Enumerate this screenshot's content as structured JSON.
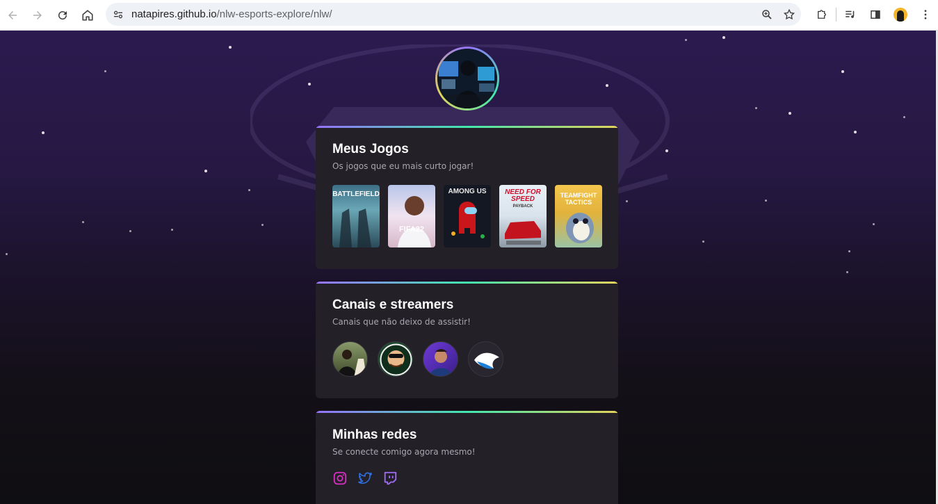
{
  "browser": {
    "url_host": "natapires.github.io",
    "url_path": "/nlw-esports-explore/nlw/"
  },
  "sections": {
    "games": {
      "title": "Meus Jogos",
      "subtitle": "Os jogos que eu mais curto jogar!",
      "items": [
        {
          "label": "BATTLEFIELD"
        },
        {
          "label": "FIFA22"
        },
        {
          "label": "AMONG US"
        },
        {
          "label": "NEED FOR SPEED"
        },
        {
          "label": "PAYBACK"
        },
        {
          "label": "TEAMFIGHT TACTICS"
        }
      ]
    },
    "streamers": {
      "title": "Canais e streamers",
      "subtitle": "Canais que não deixo de assistir!"
    },
    "social": {
      "title": "Minhas redes",
      "subtitle": "Se conecte comigo agora mesmo!"
    }
  },
  "colors": {
    "accent_purple": "#9572fc",
    "accent_green": "#43e7ad",
    "accent_yellow": "#e2d45c",
    "card_bg": "#232028",
    "instagram": "#d62fbf",
    "twitter": "#2f6fe0",
    "twitch": "#a16cf7"
  },
  "icons": [
    "back-icon",
    "forward-icon",
    "reload-icon",
    "home-icon",
    "site-settings-icon",
    "zoom-icon",
    "bookmark-star-icon",
    "extensions-icon",
    "media-control-icon",
    "side-panel-icon",
    "kebab-menu-icon",
    "instagram-icon",
    "twitter-icon",
    "twitch-icon"
  ]
}
